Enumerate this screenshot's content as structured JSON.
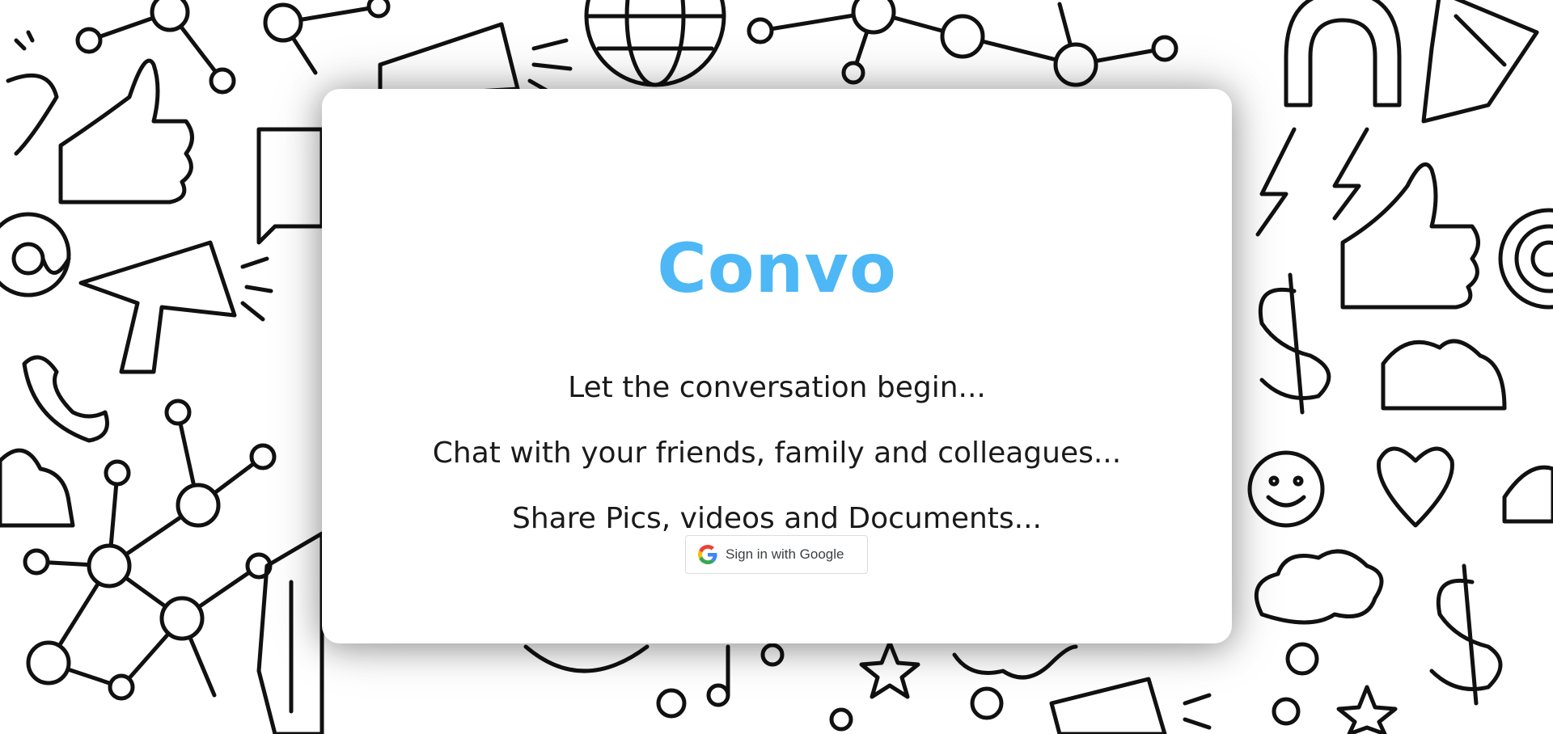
{
  "app": {
    "title": "Convo"
  },
  "hero": {
    "lines": [
      "Let the conversation begin...",
      "Chat with your friends, family and colleagues...",
      "Share Pics, videos and Documents..."
    ]
  },
  "auth": {
    "google_button_label": "Sign in with Google"
  },
  "colors": {
    "brand": "#4db8f5",
    "text": "#1a1a1a",
    "background_doodle": "#111111"
  },
  "background": {
    "icons": [
      "network-icon",
      "thumbs-up-icon",
      "megaphone-icon",
      "globe-icon",
      "phone-icon",
      "at-sign-icon",
      "magnet-icon",
      "pencil-icon",
      "lightning-icon",
      "dollar-icon",
      "people-icon",
      "smiley-icon",
      "heart-icon",
      "cloud-icon",
      "star-icon",
      "music-note-icon",
      "spiral-icon",
      "speech-bubble-icon"
    ]
  }
}
